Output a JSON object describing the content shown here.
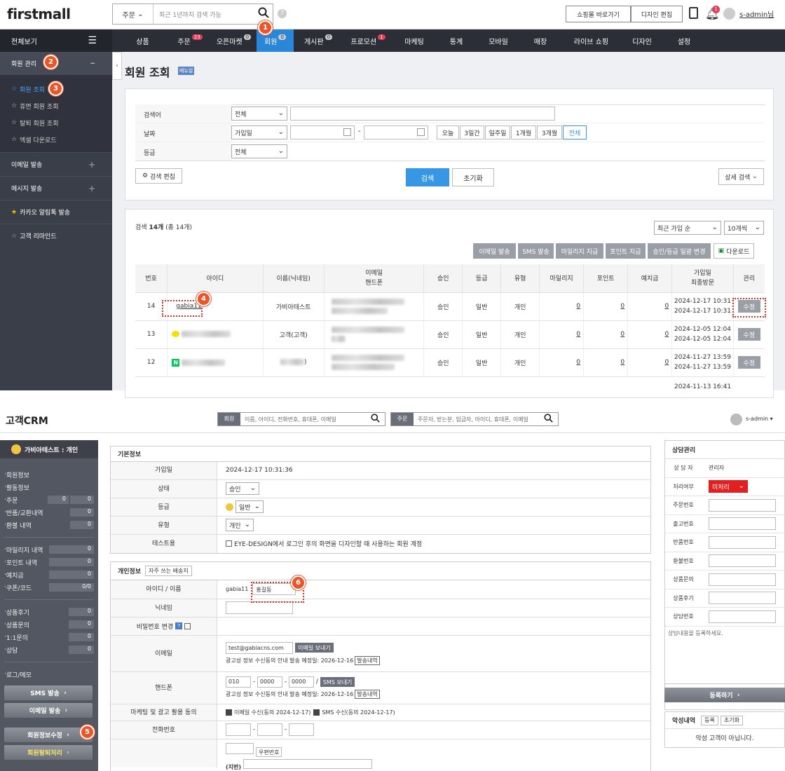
{
  "top": {
    "logo": "firstmall",
    "search_scope": "주문",
    "search_placeholder": "최근 1년까지 검색 가능",
    "shop_button": "쇼핑몰 바로가기",
    "design_button": "디자인 편집",
    "bell_count": "1",
    "user": "s-admin님"
  },
  "nav": {
    "all": "전체보기",
    "items": [
      {
        "label": "상품",
        "badge": ""
      },
      {
        "label": "주문",
        "badge": "23"
      },
      {
        "label": "오픈마켓",
        "badge": "0"
      },
      {
        "label": "회원",
        "badge": "0"
      },
      {
        "label": "게시판",
        "badge": "0"
      },
      {
        "label": "프로모션",
        "badge": "1"
      },
      {
        "label": "마케팅",
        "badge": ""
      },
      {
        "label": "통계",
        "badge": ""
      },
      {
        "label": "모바일",
        "badge": ""
      },
      {
        "label": "매장",
        "badge": ""
      },
      {
        "label": "라이브 쇼핑",
        "badge": ""
      },
      {
        "label": "디자인",
        "badge": ""
      },
      {
        "label": "설정",
        "badge": ""
      }
    ]
  },
  "sidebar": {
    "section": "회원 관리",
    "collapse": "−",
    "subs": [
      "회원 조회",
      "휴면 회원 조회",
      "탈퇴 회원 조회",
      "엑셀 다운로드"
    ],
    "sections": [
      {
        "label": "이메일 발송",
        "icon": "+"
      },
      {
        "label": "메시지 발송",
        "icon": "+"
      },
      {
        "label": "카카오 알림톡 발송",
        "icon": ""
      },
      {
        "label": "고객 리마인드",
        "icon": ""
      }
    ]
  },
  "page": {
    "title": "회원 조회",
    "manual": "매뉴얼"
  },
  "filter": {
    "keyword_label": "검색어",
    "keyword_scope": "전체",
    "date_label": "날짜",
    "date_type": "가입일",
    "date_sep": "-",
    "periods": [
      "오늘",
      "3일간",
      "일주일",
      "1개월",
      "3개월",
      "전체"
    ],
    "grade_label": "등급",
    "grade_value": "전체",
    "edit_button": "검색 편집",
    "search_button": "검색",
    "reset_button": "초기화",
    "detail_button": "상세 검색"
  },
  "results": {
    "count_prefix": "검색",
    "count_num": "14개",
    "count_suffix": "(총 14개)",
    "sort": "최근 가입 순",
    "per_page": "10개씩",
    "actions": [
      "이메일 발송",
      "SMS 발송",
      "마일리지 지급",
      "포인트 지급",
      "승인/등급 일괄 변경"
    ],
    "download": "다운로드",
    "columns": [
      "번호",
      "아이디",
      "이름(닉네임)",
      "이메일\n핸드폰",
      "승인",
      "등급",
      "유형",
      "마일리지",
      "포인트",
      "예치금",
      "가입일\n최종방문",
      "관리"
    ],
    "rows": [
      {
        "no": "14",
        "id": "gabia11",
        "name": "가비아테스트",
        "approve": "승인",
        "grade": "일반",
        "type": "개인",
        "mileage": "0",
        "point": "0",
        "deposit": "0",
        "join": "2024-12-17 10:31",
        "visit": "2024-12-17 10:31",
        "action": "수정"
      },
      {
        "no": "13",
        "id": "",
        "name": "고객(고객)",
        "approve": "승인",
        "grade": "일반",
        "type": "개인",
        "mileage": "0",
        "point": "0",
        "deposit": "0",
        "join": "2024-12-05 12:04",
        "visit": "2024-12-05 12:04",
        "action": "수정"
      },
      {
        "no": "12",
        "id": "",
        "name": ")",
        "approve": "승인",
        "grade": "일반",
        "type": "개인",
        "mileage": "0",
        "point": "0",
        "deposit": "0",
        "join": "2024-11-27 13:59",
        "visit": "2024-11-27 13:59",
        "action": "수정"
      }
    ],
    "partial_join": "2024-11-13 16:41"
  },
  "crm": {
    "title": "고객CRM",
    "member_tag": "회원",
    "member_placeholder": "이름, 아이디, 전화번호, 휴대폰, 이메일",
    "order_tag": "주문",
    "order_placeholder": "주문자, 받는분, 입금자, 아이디, 휴대폰, 이메일",
    "user": "s-admin",
    "customer": "가비아테스트 : 개인",
    "menu1": [
      {
        "label": "회원정보",
        "v1": "",
        "v2": ""
      },
      {
        "label": "활동정보",
        "v1": "",
        "v2": ""
      },
      {
        "label": "주문",
        "v1": "0",
        "v2": "0"
      },
      {
        "label": "반품/교환내역",
        "v1": "",
        "v2": "0"
      },
      {
        "label": "환불 내역",
        "v1": "",
        "v2": "0"
      }
    ],
    "menu2": [
      {
        "label": "마일리지 내역",
        "v": "0"
      },
      {
        "label": "포인트 내역",
        "v": "0"
      },
      {
        "label": "예치금",
        "v": "0"
      },
      {
        "label": "쿠폰/코드",
        "v": "0/0"
      }
    ],
    "menu3": [
      {
        "label": "상품후기",
        "v": "0"
      },
      {
        "label": "상품문의",
        "v": "0"
      },
      {
        "label": "1:1문의",
        "v": "0"
      },
      {
        "label": "상담",
        "v": "0"
      }
    ],
    "log": "로그/메모",
    "buttons": [
      "SMS 발송",
      "이메일 발송",
      "회원정보수정",
      "회원탈퇴처리"
    ]
  },
  "basic": {
    "title": "기본정보",
    "join_label": "가입일",
    "join_value": "2024-12-17 10:31:36",
    "status_label": "상태",
    "status_value": "승인",
    "grade_label": "등급",
    "grade_value": "일반",
    "type_label": "유형",
    "type_value": "개인",
    "test_label": "테스트용",
    "test_text": "EYE-DESIGN에서 로그인 후의 화면을 디자인할 때 사용하는 회원 계정"
  },
  "personal": {
    "title": "개인정보",
    "addr_button": "자주 쓰는 배송지",
    "idname_label": "아이디 / 이름",
    "id": "gabia11",
    "name": "홍길동",
    "nick_label": "닉네임",
    "pw_label": "비밀번호 변경",
    "pw_help": "?",
    "email_label": "이메일",
    "email": "test@gabiacns.com",
    "email_button": "이메일 보내기",
    "email_note": "광고성 정보 수신동의 안내 발송 예정일: 2026-12-16",
    "history_button": "발송내역",
    "phone_label": "핸드폰",
    "p1": "010",
    "p2": "0000",
    "p3": "0000",
    "sms_button": "SMS 보내기",
    "phone_note": "광고성 정보 수신동의 안내 발송 예정일: 2026-12-16",
    "mkt_label": "마케팅 및 광고 활용 동의",
    "mkt_email": "이메일 수신(동의 2024-12-17)",
    "mkt_sms": "SMS 수신(동의 2024-12-17)",
    "tel_label": "전화번호",
    "zip_button": "우편번호",
    "addr_partial": "(지번)"
  },
  "consult": {
    "title": "상담관리",
    "counselor_label": "상 담 자",
    "counselor": "관리자",
    "process_label": "처리여부",
    "process_value": "미처리",
    "fields": [
      "주문번호",
      "출고번호",
      "반품번호",
      "환불번호",
      "상품문의",
      "상품후기",
      "상담번호"
    ],
    "placeholder": "상담내용을 등록하세요.",
    "register": "등록하기",
    "bad_title": "악성내역",
    "bad_reg": "등록",
    "bad_reset": "초기화",
    "bad_text": "악성 고객이 아닙니다."
  },
  "steps": [
    "1",
    "2",
    "3",
    "4",
    "5",
    "6"
  ],
  "colors": {
    "nav_bg": "#2b2e37",
    "active_tab": "#2a86d8",
    "primary": "#3797e4",
    "sidebar_bg": "#3a3e49",
    "crm_sidebar": "#535762"
  }
}
